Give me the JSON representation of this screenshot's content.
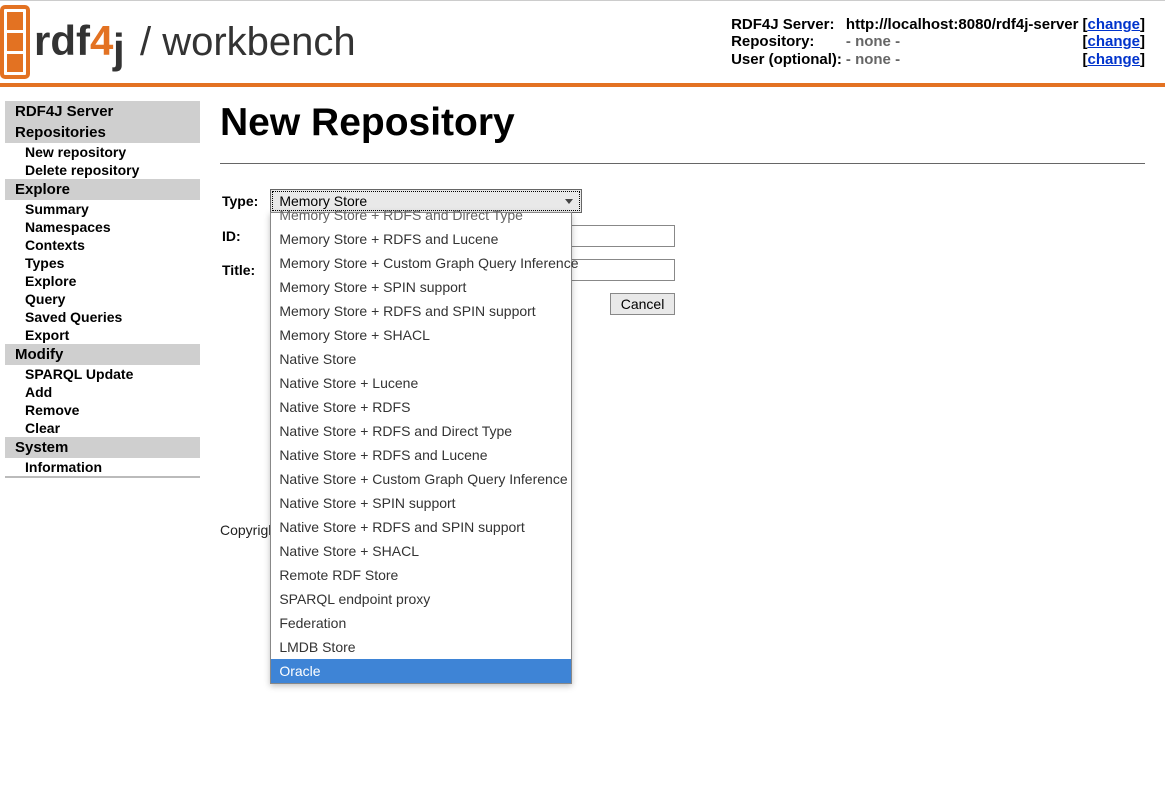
{
  "header": {
    "workbench_label": "/ workbench",
    "server_info": {
      "rows": [
        {
          "label": "RDF4J Server:",
          "value": "http://localhost:8080/rdf4j-server",
          "change": "change"
        },
        {
          "label": "Repository:",
          "value": "- none -",
          "change": "change"
        },
        {
          "label": "User (optional):",
          "value": "- none -",
          "change": "change"
        }
      ]
    }
  },
  "sidebar": {
    "sections": [
      {
        "header": "RDF4J Server",
        "items": []
      },
      {
        "header": "Repositories",
        "items": [
          "New repository",
          "Delete repository"
        ]
      },
      {
        "header": "Explore",
        "items": [
          "Summary",
          "Namespaces",
          "Contexts",
          "Types",
          "Explore",
          "Query",
          "Saved Queries",
          "Export"
        ]
      },
      {
        "header": "Modify",
        "items": [
          "SPARQL Update",
          "Add",
          "Remove",
          "Clear"
        ]
      },
      {
        "header": "System",
        "items": [
          "Information"
        ]
      }
    ]
  },
  "page": {
    "title": "New Repository",
    "copyright": "Copyrigh"
  },
  "form": {
    "type_label": "Type:",
    "id_label": "ID:",
    "title_label": "Title:",
    "cancel_label": "Cancel",
    "id_value": "",
    "title_value": "",
    "type_selected": "Memory Store",
    "type_options_visible": [
      "Memory Store + RDFS and Direct Type",
      "Memory Store + RDFS and Lucene",
      "Memory Store + Custom Graph Query Inference",
      "Memory Store + SPIN support",
      "Memory Store + RDFS and SPIN support",
      "Memory Store + SHACL",
      "Native Store",
      "Native Store + Lucene",
      "Native Store + RDFS",
      "Native Store + RDFS and Direct Type",
      "Native Store + RDFS and Lucene",
      "Native Store + Custom Graph Query Inference",
      "Native Store + SPIN support",
      "Native Store + RDFS and SPIN support",
      "Native Store + SHACL",
      "Remote RDF Store",
      "SPARQL endpoint proxy",
      "Federation",
      "LMDB Store",
      "Oracle"
    ],
    "type_option_highlighted": "Oracle"
  }
}
